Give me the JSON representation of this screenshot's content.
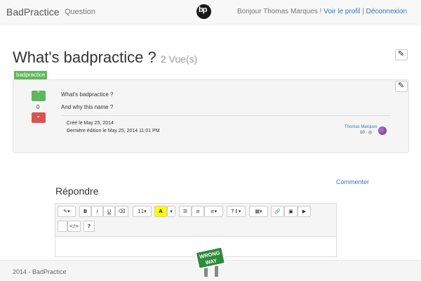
{
  "navbar": {
    "brand": "BadPractice",
    "question_link": "Question",
    "logo_text": "bp",
    "greeting": "Bonjour Thomas Marques ! ",
    "profile_link": "Voir le profil",
    "separator": " | ",
    "logout_link": "Déconnexion"
  },
  "question": {
    "title": "What's badpractice ?",
    "views": "2 Vue(s)",
    "tag": "badpractice",
    "score": "0",
    "body_line1": "What's badpractice ?",
    "body_line2": "And why this name ?",
    "created": "Créé le May 25, 2014",
    "edited": "Dernière édition le May 25, 2014 11:01 PM",
    "author": "Thomas Marques",
    "author_rep": "10 · ◎"
  },
  "actions": {
    "comment": "Commenter",
    "answer_heading": "Répondre"
  },
  "editor": {
    "font_size": "11",
    "color_label": "A",
    "help_label": "?",
    "code_label": "</>"
  },
  "sign": {
    "line1": "WRONG",
    "line2": "WAY"
  },
  "footer": {
    "text": "2014 - BadPractice"
  },
  "colors": {
    "success": "#5cb85c",
    "danger": "#d9534f",
    "link": "#337ab7"
  }
}
